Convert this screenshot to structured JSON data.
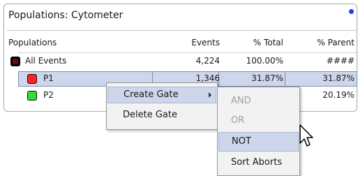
{
  "panel": {
    "title": "Populations: Cytometer",
    "dot_color": "#1f3bff"
  },
  "table": {
    "headers": [
      "Populations",
      "Events",
      "% Total",
      "% Parent"
    ],
    "rows": [
      {
        "name": "All Events",
        "events": "4,224",
        "total": "100.00%",
        "parent": "####",
        "color": "#000000"
      },
      {
        "name": "P1",
        "events": "1,346",
        "total": "31.87%",
        "parent": "31.87%",
        "color": "#ff2020",
        "selected": true
      },
      {
        "name": "P2",
        "events": "",
        "total": "",
        "parent": "20.19%",
        "color": "#33dd33"
      }
    ]
  },
  "context_menu": {
    "items": [
      "Create Gate",
      "Delete Gate"
    ]
  },
  "submenu": {
    "items": [
      {
        "label": "AND",
        "enabled": false
      },
      {
        "label": "OR",
        "enabled": false
      },
      {
        "label": "NOT",
        "enabled": true,
        "highlighted": true
      },
      {
        "label": "Sort Aborts",
        "enabled": true
      }
    ]
  },
  "cursor_icon": "arrow-pointer"
}
